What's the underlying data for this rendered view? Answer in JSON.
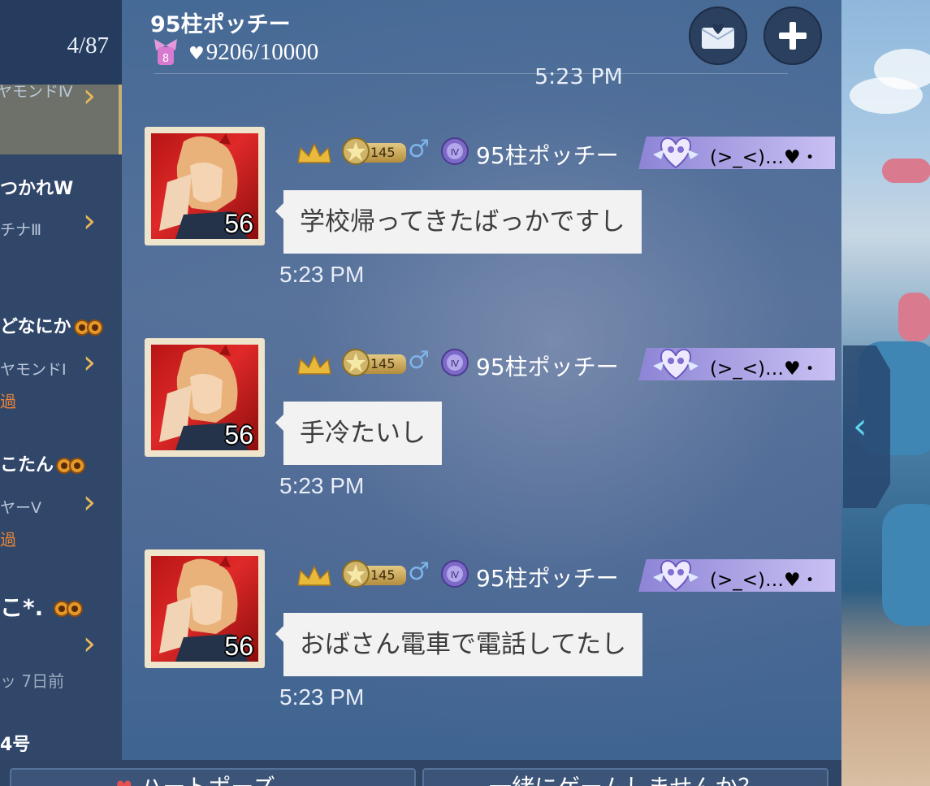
{
  "friend_list": {
    "count": "4/87",
    "items": [
      {
        "name": "",
        "rank": "ヤモンドⅣ",
        "ago": "",
        "selected": true
      },
      {
        "name": "つかれW",
        "rank": "チナⅢ",
        "ago": ""
      },
      {
        "name": "どなにか",
        "rank": "ヤモンドⅠ",
        "ago": "過"
      },
      {
        "name": "こたん",
        "rank": "ヤーⅤ",
        "ago": "過"
      },
      {
        "name": "こ*.",
        "rank": "",
        "ago": "ッ 7日前"
      },
      {
        "name": "4号",
        "rank": "",
        "ago": ""
      }
    ]
  },
  "chat": {
    "title": "95柱ポッチー",
    "bow_level": "8",
    "intimacy": "9206/10000",
    "clipped_time": "5:23 PM",
    "messages": [
      {
        "avatar_level": "56",
        "level_tag": "145",
        "sender": "95柱ポッチー",
        "title_text": "(>_<)…♥・",
        "text": "学校帰ってきたばっかですし",
        "time": "5:23 PM"
      },
      {
        "avatar_level": "56",
        "level_tag": "145",
        "sender": "95柱ポッチー",
        "title_text": "(>_<)…♥・",
        "text": "手冷たいし",
        "time": "5:23 PM"
      },
      {
        "avatar_level": "56",
        "level_tag": "145",
        "sender": "95柱ポッチー",
        "title_text": "(>_<)…♥・",
        "text": "おばさん電車で電話してたし",
        "time": "5:23 PM"
      }
    ]
  },
  "bottom_bar": {
    "left_button": "ハートポーズ",
    "right_button": "一緒にゲームしませんか？"
  },
  "icons": {
    "mail": "mail-heart-icon",
    "add": "plus-icon",
    "collapse": "chevron-left-icon",
    "crown": "crown-icon",
    "star": "star-badge-icon",
    "male": "male-icon",
    "rank_badge": "rank-badge-icon"
  },
  "colors": {
    "chat_bg": "#4d6a95",
    "friend_panel": "#30476a",
    "bubble": "#f2f2f2",
    "accent_gold": "#e9b65a",
    "recent_orange": "#e7823a",
    "banner_purple": "#8d84d6"
  }
}
